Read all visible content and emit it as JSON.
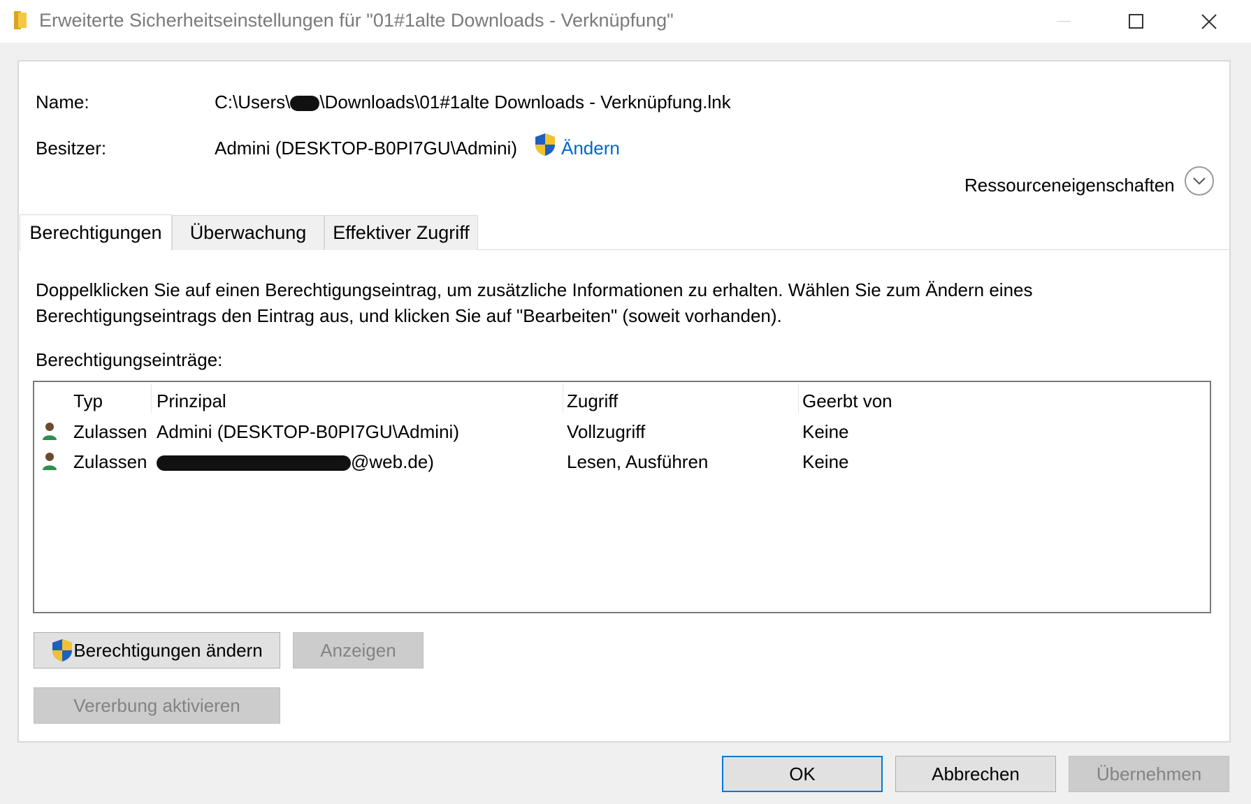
{
  "window": {
    "title": "Erweiterte Sicherheitseinstellungen für \"01#1alte Downloads - Verknüpfung\""
  },
  "info": {
    "name_label": "Name:",
    "name_value_prefix": "C:\\Users\\",
    "name_value_suffix": "\\Downloads\\01#1alte Downloads - Verknüpfung.lnk",
    "owner_label": "Besitzer:",
    "owner_value": "Admini (DESKTOP-B0PI7GU\\Admini)",
    "owner_change_link": "Ändern",
    "resource_properties": "Ressourceneigenschaften"
  },
  "tabs": [
    {
      "label": "Berechtigungen",
      "active": true
    },
    {
      "label": "Überwachung",
      "active": false
    },
    {
      "label": "Effektiver Zugriff",
      "active": false
    }
  ],
  "permissions": {
    "description_line1": "Doppelklicken Sie auf einen Berechtigungseintrag, um zusätzliche Informationen zu erhalten. Wählen Sie zum Ändern eines",
    "description_line2": "Berechtigungseintrags den Eintrag aus, und klicken Sie auf \"Bearbeiten\" (soweit vorhanden).",
    "entries_label": "Berechtigungseinträge:",
    "columns": [
      "Typ",
      "Prinzipal",
      "Zugriff",
      "Geerbt von"
    ],
    "rows": [
      {
        "type": "Zulassen",
        "principal": "Admini (DESKTOP-B0PI7GU\\Admini)",
        "access": "Vollzugriff",
        "inherited": "Keine"
      },
      {
        "type": "Zulassen",
        "principal": "@web.de)",
        "access": "Lesen, Ausführen",
        "inherited": "Keine"
      }
    ]
  },
  "buttons": {
    "change_permissions": "Berechtigungen ändern",
    "view": "Anzeigen",
    "enable_inheritance": "Vererbung aktivieren",
    "ok": "OK",
    "cancel": "Abbrechen",
    "apply": "Übernehmen"
  },
  "colors": {
    "link": "#0066cc",
    "default_button_border": "#0078d7",
    "disabled_text": "#838383"
  }
}
